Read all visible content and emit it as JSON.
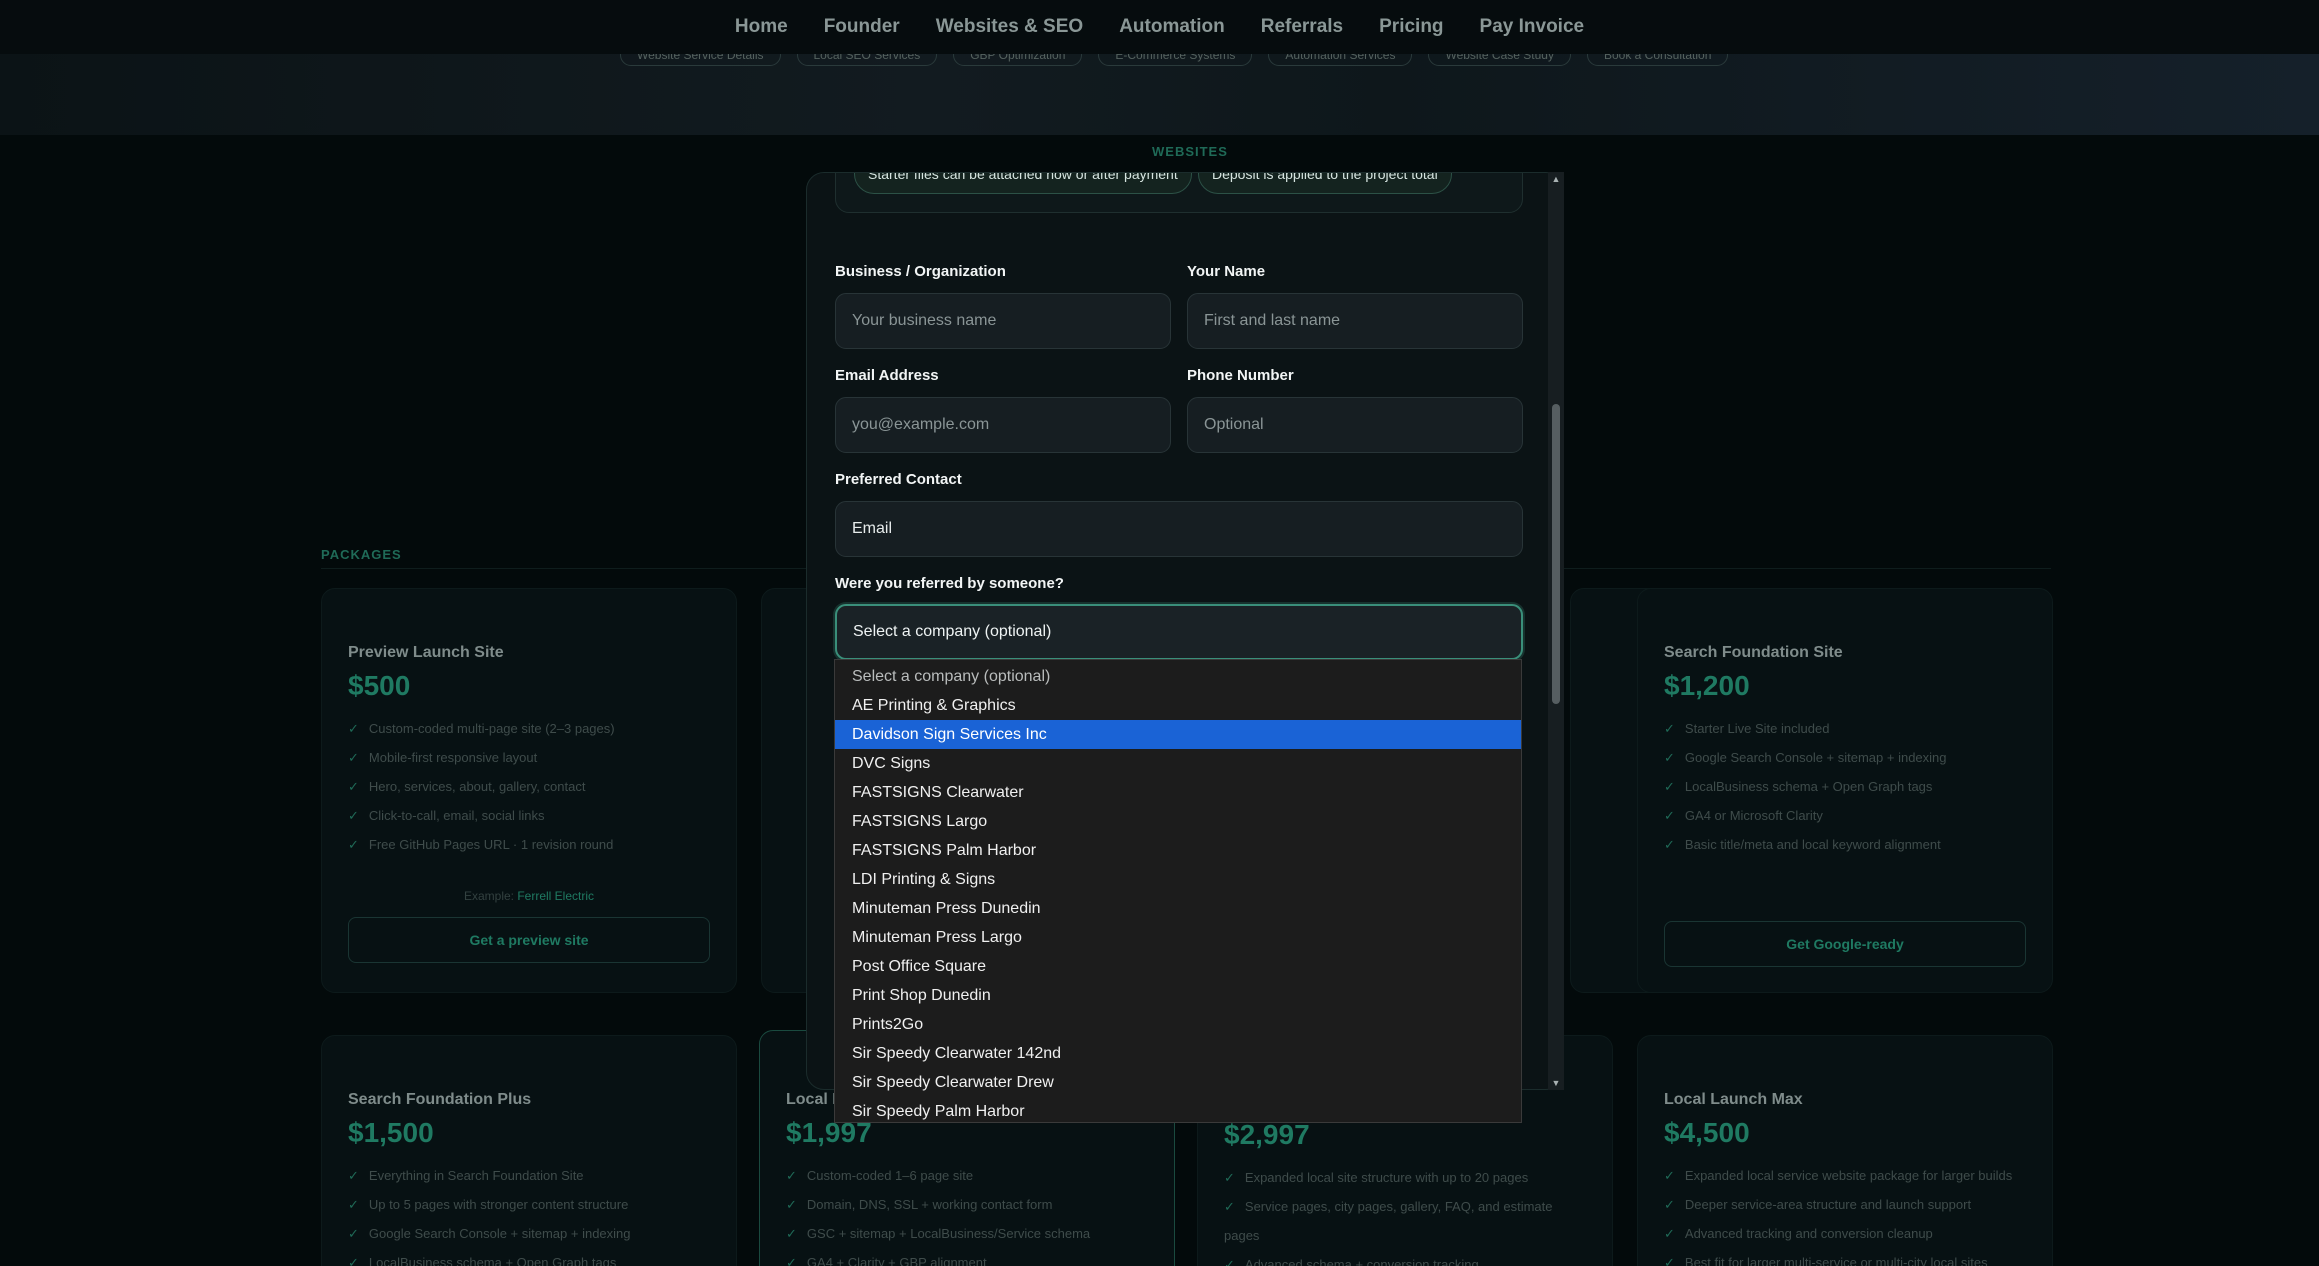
{
  "nav": {
    "items": [
      "Home",
      "Founder",
      "Websites & SEO",
      "Automation",
      "Referrals",
      "Pricing",
      "Pay Invoice"
    ],
    "subnav": [
      "Website Service Details",
      "Local SEO Services",
      "GBP Optimization",
      "E-Commerce Systems",
      "Automation Services",
      "Website Case Study",
      "Book a Consultation"
    ]
  },
  "sections": {
    "websites": "WEBSITES",
    "packages": "PACKAGES"
  },
  "cards": [
    {
      "title": "Preview Launch Site",
      "price": "$500",
      "features": [
        "Custom-coded multi-page site (2–3 pages)",
        "Mobile-first responsive layout",
        "Hero, services, about, gallery, contact",
        "Click-to-call, email, social links",
        "Free GitHub Pages URL · 1 revision round"
      ],
      "example_prefix": "Example:",
      "example_link": "Ferrell Electric",
      "button": "Get a preview site"
    },
    {
      "title": "Search Foundation Site",
      "price": "$1,200",
      "features": [
        "Starter Live Site included",
        "Google Search Console + sitemap + indexing",
        "LocalBusiness schema + Open Graph tags",
        "GA4 or Microsoft Clarity",
        "Basic title/meta and local keyword alignment"
      ],
      "button": "Get Google-ready"
    },
    {
      "title": "Search Foundation Plus",
      "price": "$1,500",
      "features": [
        "Everything in Search Foundation Site",
        "Up to 5 pages with stronger content structure",
        "Google Search Console + sitemap + indexing",
        "LocalBusiness schema + Open Graph tags"
      ]
    },
    {
      "title": "Local I",
      "price": "$1,997",
      "features": [
        "Custom-coded 1–6 page site",
        "Domain, DNS, SSL + working contact form",
        "GSC + sitemap + LocalBusiness/Service schema",
        "GA4 + Clarity + GBP alignment"
      ]
    },
    {
      "title": "",
      "price": "$2,997",
      "features": [
        "Expanded local site structure with up to 20 pages",
        "Service pages, city pages, gallery, FAQ, and estimate pages",
        "Advanced schema + conversion tracking"
      ]
    },
    {
      "title": "Local Launch Max",
      "price": "$4,500",
      "features": [
        "Expanded local service website package for larger builds",
        "Deeper service-area structure and launch support",
        "Advanced tracking and conversion cleanup",
        "Best fit for larger multi-service or multi-city local sites"
      ]
    }
  ],
  "modal": {
    "pills": [
      "Starter files can be attached now or after payment",
      "Deposit is applied to the project total"
    ],
    "business_label": "Business / Organization",
    "business_placeholder": "Your business name",
    "name_label": "Your Name",
    "name_placeholder": "First and last name",
    "email_label": "Email Address",
    "email_placeholder": "you@example.com",
    "phone_label": "Phone Number",
    "phone_placeholder": "Optional",
    "contact_label": "Preferred Contact",
    "contact_value": "Email",
    "referral_label": "Were you referred by someone?",
    "referral_value": "Select a company (optional)"
  },
  "dropdown": {
    "options": [
      "Select a company (optional)",
      "AE Printing & Graphics",
      "Davidson Sign Services Inc",
      "DVC Signs",
      "FASTSIGNS Clearwater",
      "FASTSIGNS Largo",
      "FASTSIGNS Palm Harbor",
      "LDI Printing & Signs",
      "Minuteman Press Dunedin",
      "Minuteman Press Largo",
      "Post Office Square",
      "Print Shop Dunedin",
      "Prints2Go",
      "Sir Speedy Clearwater 142nd",
      "Sir Speedy Clearwater Drew",
      "Sir Speedy Palm Harbor"
    ],
    "highlighted_index": 2
  },
  "colors": {
    "accent": "#1f7a62",
    "highlight": "#1a63d6",
    "focus_border": "#3a8f7a"
  }
}
